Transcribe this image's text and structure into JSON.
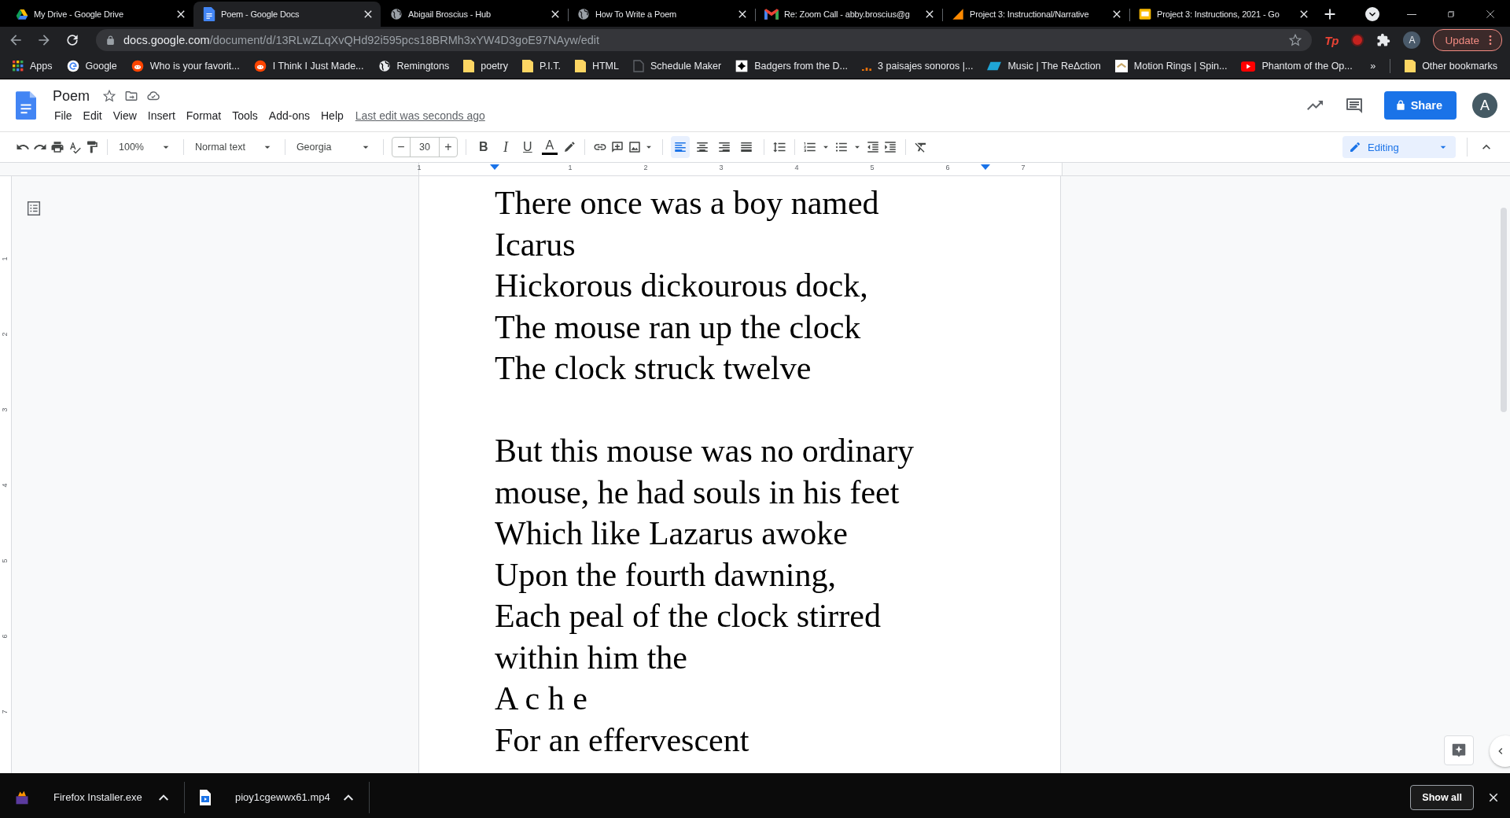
{
  "browser_tabs": [
    {
      "title": "My Drive - Google Drive",
      "kind": "drive",
      "selected": false
    },
    {
      "title": "Poem - Google Docs",
      "kind": "docs",
      "selected": true
    },
    {
      "title": "Abigail Broscius - Hub",
      "kind": "globe",
      "selected": false
    },
    {
      "title": "How To Write a Poem",
      "kind": "globe",
      "selected": false
    },
    {
      "title": "Re: Zoom Call - abby.broscius@g",
      "kind": "mail",
      "selected": false
    },
    {
      "title": "Project 3: Instructional/Narrative",
      "kind": "wedge",
      "selected": false
    },
    {
      "title": "Project 3: Instructions, 2021 - Go",
      "kind": "slides",
      "selected": false
    }
  ],
  "address_bar": {
    "host": "docs.google.com",
    "path": "/document/d/13RLwZLqXvQHd92i595pcs18BRMh3xYW4D3goE97NAyw/edit"
  },
  "extensions": {
    "tp": "Tp",
    "profile": "A",
    "update": "Update"
  },
  "bookmarks": [
    {
      "label": "Apps",
      "kind": "apps"
    },
    {
      "label": "Google",
      "kind": "google"
    },
    {
      "label": "Who is your favorit...",
      "kind": "reddit"
    },
    {
      "label": "I Think I Just Made...",
      "kind": "reddit"
    },
    {
      "label": "Remingtons",
      "kind": "globe"
    },
    {
      "label": "poetry",
      "kind": "folder"
    },
    {
      "label": "P.I.T.",
      "kind": "folder"
    },
    {
      "label": "HTML",
      "kind": "folder"
    },
    {
      "label": "Schedule Maker",
      "kind": "page"
    },
    {
      "label": "Badgers from the D...",
      "kind": "badge"
    },
    {
      "label": "3 paisajes sonoros |...",
      "kind": "dots"
    },
    {
      "label": "Music | The ReΔction",
      "kind": "stripe"
    },
    {
      "label": "Motion Rings | Spin...",
      "kind": "tile"
    },
    {
      "label": "Phantom of the Op...",
      "kind": "video"
    }
  ],
  "bookmarks_overflow": "»",
  "other_bookmarks": "Other bookmarks",
  "document": {
    "title": "Poem",
    "menus": [
      "File",
      "Edit",
      "View",
      "Insert",
      "Format",
      "Tools",
      "Add-ons",
      "Help"
    ],
    "last_edit": "Last edit was seconds ago",
    "share": "Share",
    "avatar": "A"
  },
  "toolbar": {
    "zoom": "100%",
    "style": "Normal text",
    "font": "Georgia",
    "size_minus": "−",
    "size": "30",
    "size_plus": "+",
    "bold": "B",
    "italic": "I",
    "underline": "U",
    "text_color": "A",
    "alignment": [
      {
        "selected": true
      },
      {
        "selected": false
      },
      {
        "selected": false
      },
      {
        "selected": false
      }
    ],
    "mode": "Editing"
  },
  "ruler": [
    "1",
    "1",
    "2",
    "3",
    "4",
    "5",
    "6",
    "7"
  ],
  "vertical_ruler": [
    "1",
    "2",
    "3",
    "4",
    "5",
    "6",
    "7"
  ],
  "poem": [
    [
      "There once was a boy named",
      "Icarus",
      "Hickorous dickourous dock,",
      "The mouse ran up the clock",
      "The clock struck twelve"
    ],
    [
      "But this mouse was no ordinary",
      "mouse, he had souls in his feet",
      "Which like Lazarus awoke",
      "Upon the fourth dawning,",
      "Each peal of the clock stirred",
      "within him the",
      "A c h e",
      "For an effervescent"
    ]
  ],
  "downloads": [
    {
      "name": "Firefox Installer.exe",
      "kind": "installer"
    },
    {
      "name": "pioy1cgewwx61.mp4",
      "kind": "video"
    }
  ],
  "show_all": "Show all"
}
